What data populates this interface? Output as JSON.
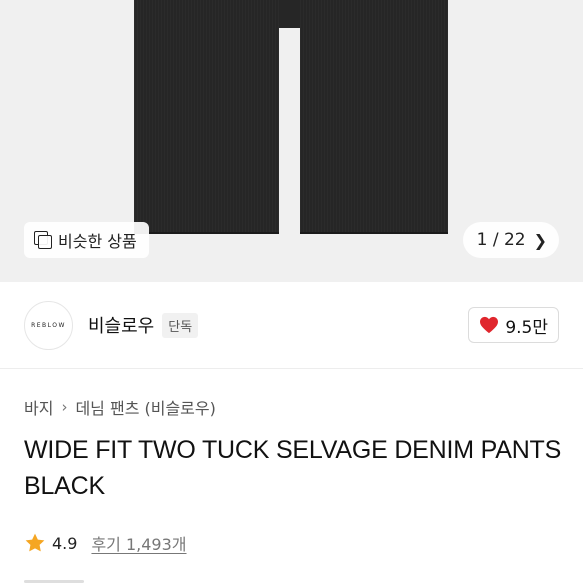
{
  "gallery": {
    "similar_label": "비슷한 상품",
    "pager": "1 / 22"
  },
  "brand": {
    "logo_text": "REBLOW",
    "name": "비슬로우",
    "exclusive_badge": "단독",
    "likes": "9.5만",
    "like_color": "#e0262d"
  },
  "breadcrumb": {
    "category": "바지",
    "subcategory": "데님 팬츠 (비슬로우)"
  },
  "product": {
    "title": "WIDE FIT TWO TUCK SELVAGE DENIM PANTS BLACK"
  },
  "rating": {
    "score": "4.9",
    "reviews": "후기 1,493개",
    "star_color": "#f5a623"
  }
}
